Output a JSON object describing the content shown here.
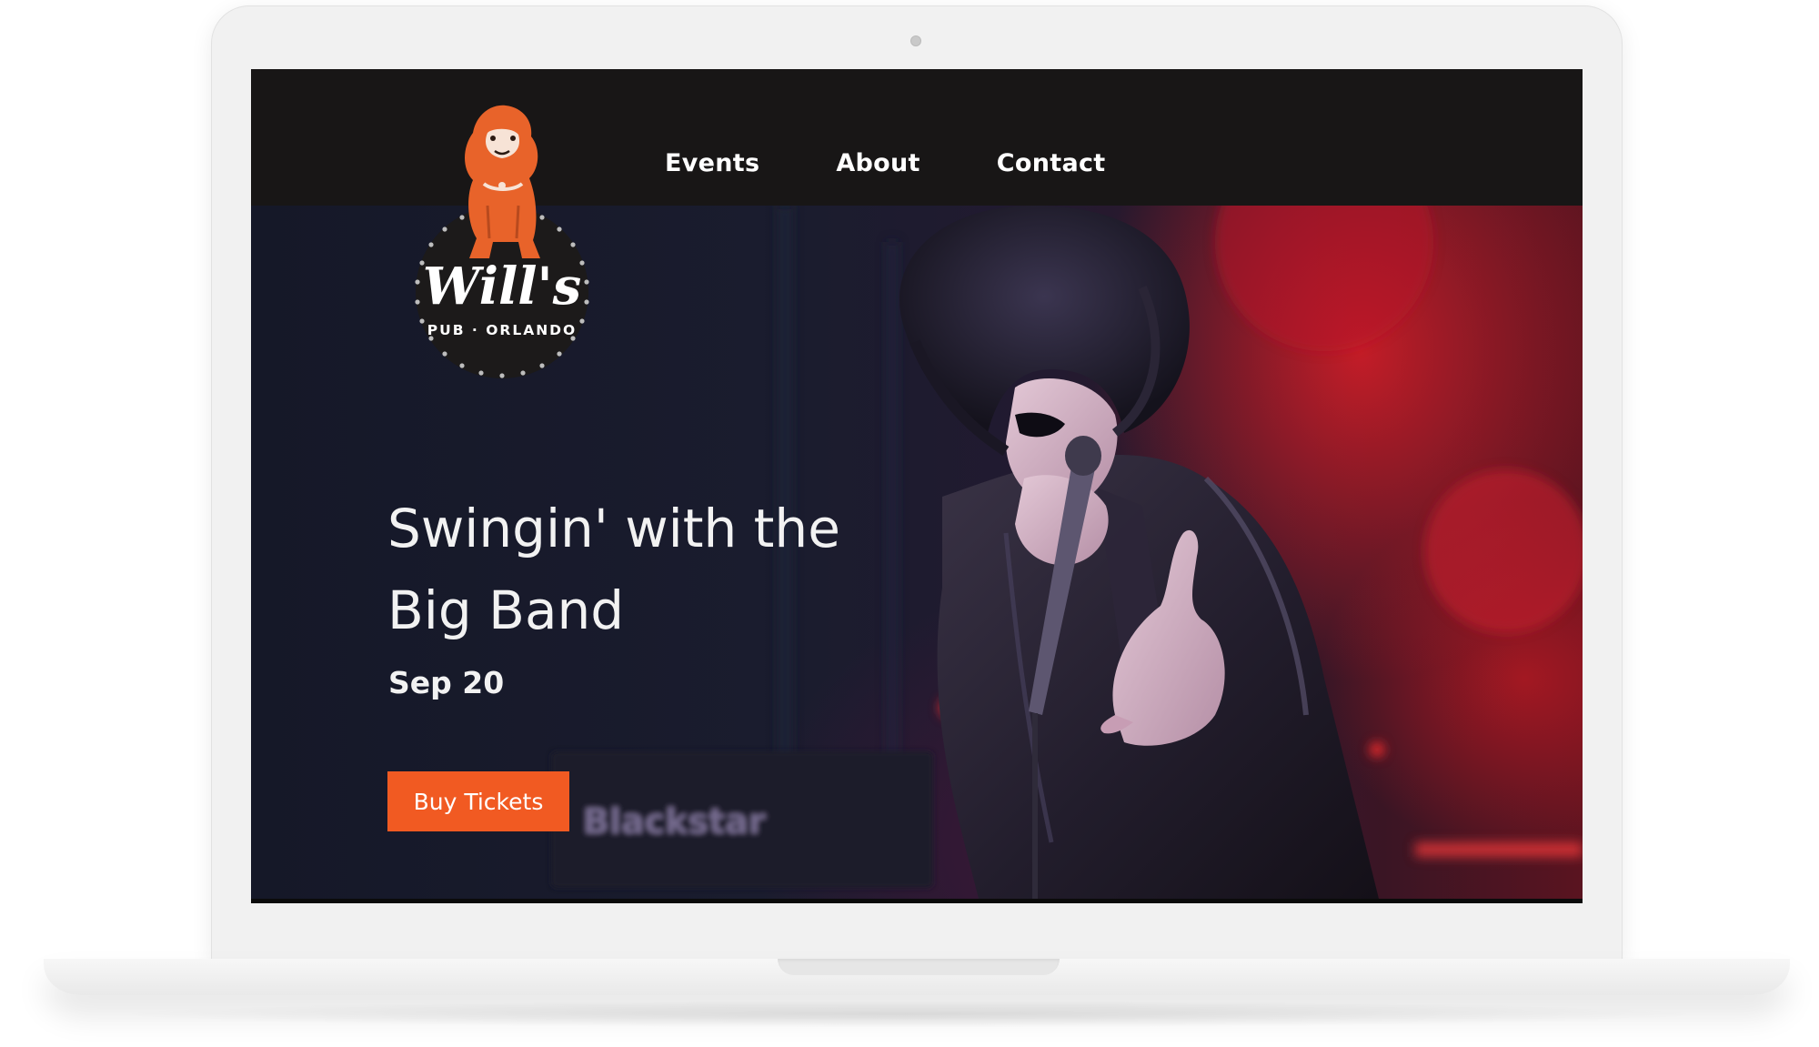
{
  "nav": {
    "items": [
      {
        "label": "Events"
      },
      {
        "label": "About"
      },
      {
        "label": "Contact"
      }
    ]
  },
  "logo": {
    "wordmark": "Will's",
    "tagline": "PUB · ORLANDO"
  },
  "hero": {
    "title": "Swingin' with the Big Band",
    "date": "Sep 20",
    "button_label": "Buy Tickets",
    "amp_brand": "Blackstar"
  },
  "colors": {
    "accent": "#f15a22",
    "navbar": "#181616",
    "hero_red": "#d81e28",
    "hero_navy": "#1a1c2e"
  }
}
